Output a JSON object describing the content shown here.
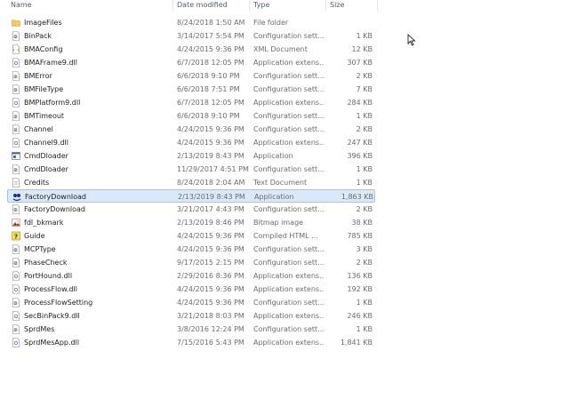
{
  "columns": {
    "name": "Name",
    "date": "Date modified",
    "type": "Type",
    "size": "Size"
  },
  "files": [
    {
      "name": "ImageFiles",
      "date": "8/24/2018 1:50 AM",
      "type": "File folder",
      "size": "",
      "icon": "folder-icon"
    },
    {
      "name": "BinPack",
      "date": "3/14/2017 5:54 PM",
      "type": "Configuration sett...",
      "size": "1 KB",
      "icon": "config-file-icon"
    },
    {
      "name": "BMAConfig",
      "date": "4/24/2015 9:36 PM",
      "type": "XML Document",
      "size": "12 KB",
      "icon": "xml-file-icon"
    },
    {
      "name": "BMAFrame9.dll",
      "date": "6/7/2018 12:05 PM",
      "type": "Application extens...",
      "size": "307 KB",
      "icon": "dll-file-icon"
    },
    {
      "name": "BMError",
      "date": "6/6/2018 9:10 PM",
      "type": "Configuration sett...",
      "size": "2 KB",
      "icon": "config-file-icon"
    },
    {
      "name": "BMFileType",
      "date": "6/6/2018 7:51 PM",
      "type": "Configuration sett...",
      "size": "7 KB",
      "icon": "config-file-icon"
    },
    {
      "name": "BMPlatform9.dll",
      "date": "6/7/2018 12:05 PM",
      "type": "Application extens...",
      "size": "284 KB",
      "icon": "dll-file-icon"
    },
    {
      "name": "BMTimeout",
      "date": "6/6/2018 9:10 PM",
      "type": "Configuration sett...",
      "size": "1 KB",
      "icon": "config-file-icon"
    },
    {
      "name": "Channel",
      "date": "4/24/2015 9:36 PM",
      "type": "Configuration sett...",
      "size": "2 KB",
      "icon": "config-file-icon"
    },
    {
      "name": "Channel9.dll",
      "date": "4/24/2015 9:36 PM",
      "type": "Application extens...",
      "size": "247 KB",
      "icon": "dll-file-icon"
    },
    {
      "name": "CmdDloader",
      "date": "2/13/2019 8:43 PM",
      "type": "Application",
      "size": "396 KB",
      "icon": "application-icon"
    },
    {
      "name": "CmdDloader",
      "date": "11/29/2017 4:51 PM",
      "type": "Configuration sett...",
      "size": "1 KB",
      "icon": "config-file-icon"
    },
    {
      "name": "Credits",
      "date": "8/24/2018 2:04 AM",
      "type": "Text Document",
      "size": "1 KB",
      "icon": "text-file-icon"
    },
    {
      "name": "FactoryDownload",
      "date": "2/13/2019 8:43 PM",
      "type": "Application",
      "size": "1,863 KB",
      "icon": "factory-download-app-icon",
      "selected": true
    },
    {
      "name": "FactoryDownload",
      "date": "3/21/2017 4:43 PM",
      "type": "Configuration sett...",
      "size": "2 KB",
      "icon": "config-file-icon"
    },
    {
      "name": "fdl_bkmark",
      "date": "2/13/2019 8:46 PM",
      "type": "Bitmap image",
      "size": "38 KB",
      "icon": "bitmap-file-icon"
    },
    {
      "name": "Guide",
      "date": "4/24/2015 9:36 PM",
      "type": "Compiled HTML ...",
      "size": "785 KB",
      "icon": "help-file-icon"
    },
    {
      "name": "MCPType",
      "date": "4/24/2015 9:36 PM",
      "type": "Configuration sett...",
      "size": "3 KB",
      "icon": "config-file-icon"
    },
    {
      "name": "PhaseCheck",
      "date": "9/17/2015 2:15 PM",
      "type": "Configuration sett...",
      "size": "2 KB",
      "icon": "config-file-icon"
    },
    {
      "name": "PortHound.dll",
      "date": "2/29/2016 8:36 PM",
      "type": "Application extens...",
      "size": "136 KB",
      "icon": "dll-file-icon"
    },
    {
      "name": "ProcessFlow.dll",
      "date": "4/24/2015 9:36 PM",
      "type": "Application extens...",
      "size": "192 KB",
      "icon": "dll-file-icon"
    },
    {
      "name": "ProcessFlowSetting",
      "date": "4/24/2015 9:36 PM",
      "type": "Configuration sett...",
      "size": "1 KB",
      "icon": "config-file-icon"
    },
    {
      "name": "SecBinPack9.dll",
      "date": "3/21/2018 8:03 PM",
      "type": "Application extens...",
      "size": "246 KB",
      "icon": "dll-file-icon"
    },
    {
      "name": "SprdMes",
      "date": "3/8/2016 12:24 PM",
      "type": "Configuration sett...",
      "size": "1 KB",
      "icon": "config-file-icon"
    },
    {
      "name": "SprdMesApp.dll",
      "date": "7/15/2016 5:43 PM",
      "type": "Application extens...",
      "size": "1,841 KB",
      "icon": "dll-file-icon"
    }
  ]
}
